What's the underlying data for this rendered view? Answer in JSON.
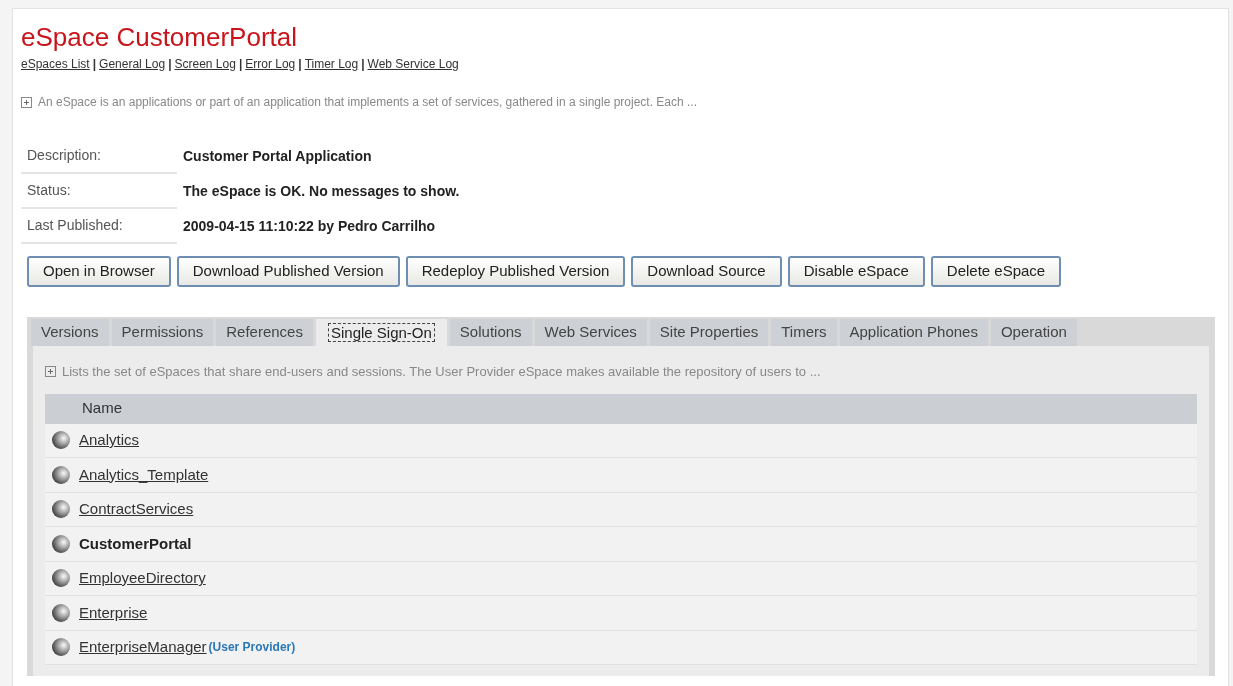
{
  "title": "eSpace CustomerPortal",
  "nav": [
    {
      "kind": "link",
      "label": "eSpaces List"
    },
    {
      "kind": "separator",
      "label": "|"
    },
    {
      "kind": "link",
      "label": "General Log"
    },
    {
      "kind": "separator",
      "label": "|"
    },
    {
      "kind": "link",
      "label": "Screen Log"
    },
    {
      "kind": "separator",
      "label": "|"
    },
    {
      "kind": "link",
      "label": "Error Log"
    },
    {
      "kind": "separator",
      "label": "|"
    },
    {
      "kind": "link",
      "label": "Timer Log"
    },
    {
      "kind": "separator",
      "label": "|"
    },
    {
      "kind": "link",
      "label": "Web Service Log"
    }
  ],
  "description": "An eSpace is an applications or part of an application that implements a set of services, gathered in a single project. Each ...",
  "details": [
    {
      "label": "Description:",
      "value": "Customer Portal Application"
    },
    {
      "label": "Status:",
      "value": "The eSpace is OK. No messages to show."
    },
    {
      "label": "Last Published:",
      "value": "2009-04-15 11:10:22 by Pedro Carrilho"
    }
  ],
  "buttons": [
    "Open in Browser",
    "Download Published Version",
    "Redeploy Published Version",
    "Download Source",
    "Disable eSpace",
    "Delete eSpace"
  ],
  "tabs": [
    {
      "label": "Versions",
      "selected": false
    },
    {
      "label": "Permissions",
      "selected": false
    },
    {
      "label": "References",
      "selected": false
    },
    {
      "label": "Single Sign-On",
      "selected": true
    },
    {
      "label": "Solutions",
      "selected": false
    },
    {
      "label": "Web Services",
      "selected": false
    },
    {
      "label": "Site Properties",
      "selected": false
    },
    {
      "label": "Timers",
      "selected": false
    },
    {
      "label": "Application Phones",
      "selected": false
    },
    {
      "label": "Operation",
      "selected": false
    }
  ],
  "panel": {
    "description": "Lists the set of eSpaces that share end-users and sessions. The User Provider eSpace makes available the repository of users to ...",
    "table": {
      "columns": [
        "Name"
      ],
      "rows": [
        {
          "kind": "link",
          "name": "Analytics"
        },
        {
          "kind": "link",
          "name": "Analytics_Template"
        },
        {
          "kind": "link",
          "name": "ContractServices"
        },
        {
          "kind": "current",
          "name": "CustomerPortal"
        },
        {
          "kind": "link",
          "name": "EmployeeDirectory"
        },
        {
          "kind": "link",
          "name": "Enterprise"
        },
        {
          "kind": "link",
          "name": "EnterpriseManager",
          "tag": "(User Provider)"
        }
      ]
    }
  }
}
